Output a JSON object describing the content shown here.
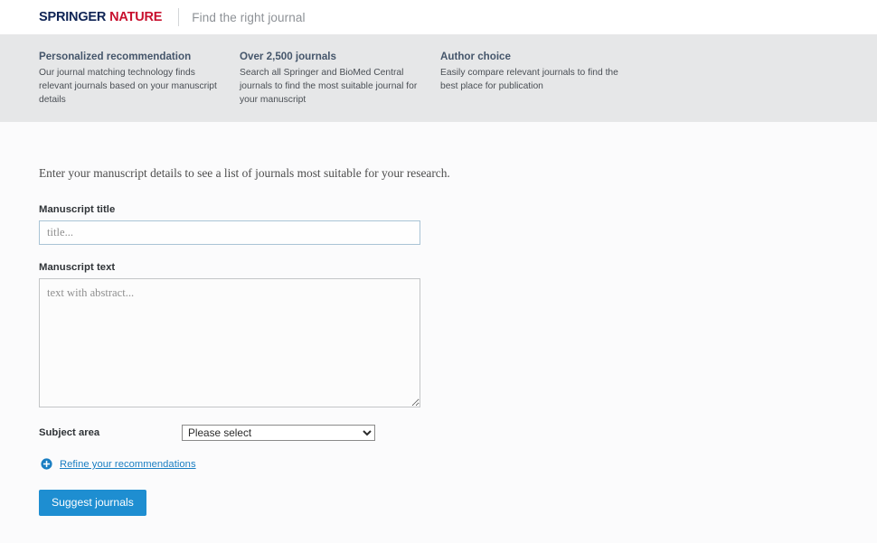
{
  "header": {
    "logo_springer": "SPRINGER",
    "logo_nature": "NATURE",
    "tagline": "Find the right journal"
  },
  "banner": {
    "columns": [
      {
        "title": "Personalized recommendation",
        "text": "Our journal matching technology finds relevant journals based on your manuscript details"
      },
      {
        "title": "Over 2,500 journals",
        "text": "Search all Springer and BioMed Central journals to find the most suitable journal for your manuscript"
      },
      {
        "title": "Author choice",
        "text": "Easily compare relevant journals to find the best place for publication"
      }
    ]
  },
  "main": {
    "intro": "Enter your manuscript details to see a list of journals most suitable for your research.",
    "title_field": {
      "label": "Manuscript title",
      "placeholder": "title...",
      "value": ""
    },
    "text_field": {
      "label": "Manuscript text",
      "placeholder": "text with abstract...",
      "value": ""
    },
    "subject_field": {
      "label": "Subject area",
      "selected": "Please select",
      "options": [
        "Please select"
      ]
    },
    "refine": {
      "icon": "plus-circle-icon",
      "label": "Refine your recommendations"
    },
    "submit_label": "Suggest journals"
  },
  "colors": {
    "brand_navy": "#0f2455",
    "brand_red": "#c8102e",
    "banner_bg": "#e6e7e8",
    "heading": "#45566b",
    "link_blue": "#1a7ec2",
    "button_blue": "#1e8ed1",
    "page_bg": "#fbfbfc"
  }
}
